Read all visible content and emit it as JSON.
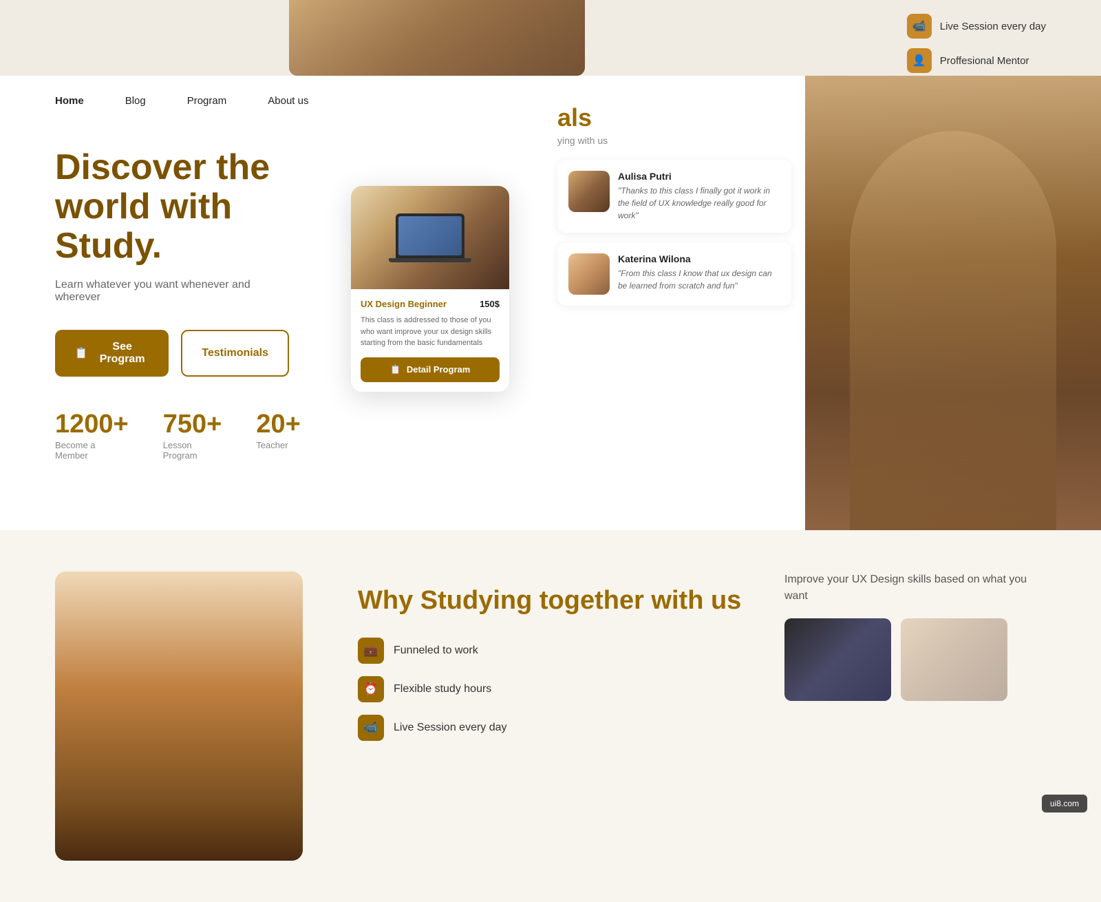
{
  "site": {
    "watermark": "ui8.com"
  },
  "top_partial": {
    "features": [
      {
        "icon": "📹",
        "label": "Live Session every day"
      },
      {
        "icon": "👤",
        "label": "Proffesional Mentor"
      }
    ]
  },
  "navbar": {
    "links": [
      {
        "label": "Home",
        "active": true
      },
      {
        "label": "Blog",
        "active": false
      },
      {
        "label": "Program",
        "active": false
      },
      {
        "label": "About us",
        "active": false
      }
    ]
  },
  "hero": {
    "title": "Discover the world with Study.",
    "subtitle": "Learn whatever you want whenever and wherever",
    "btn_primary": "See Program",
    "btn_secondary": "Testimonials",
    "stats": [
      {
        "number": "1200+",
        "label": "Become a Member"
      },
      {
        "number": "750+",
        "label": "Lesson Program"
      },
      {
        "number": "20+",
        "label": "Teacher"
      }
    ]
  },
  "course_card": {
    "title": "UX Design Beginner",
    "price": "150$",
    "description": "This class is addressed to those of you who want improve your ux design skills starting from the basic fundamentals",
    "btn_label": "Detail Program"
  },
  "testimonials": {
    "heading": "als",
    "subheading": "ying with us",
    "items": [
      {
        "name": "Aulisa Putri",
        "quote": "\"Thanks to this class I finally got it work in the field of UX knowledge really good for work\""
      },
      {
        "name": "Katerina Wilona",
        "quote": "\"From this class I know that ux design can be learned from scratch and fun\""
      }
    ]
  },
  "why_section": {
    "title": "Why Studying together with us",
    "features": [
      {
        "icon": "💼",
        "label": "Funneled to work"
      },
      {
        "icon": "⏰",
        "label": "Flexible study hours"
      },
      {
        "icon": "📹",
        "label": "Live Session every day"
      }
    ],
    "right_text": "Improve your UX Design skills based on what you want"
  }
}
